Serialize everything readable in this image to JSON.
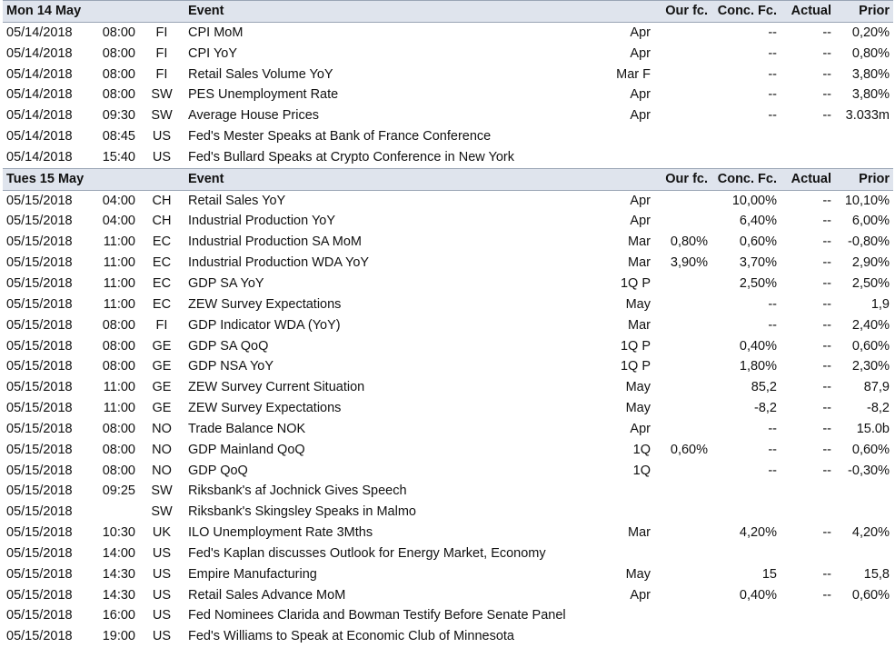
{
  "columns": {
    "event": "Event",
    "our_fc": "Our fc.",
    "conc_fc": "Conc. Fc.",
    "actual": "Actual",
    "prior": "Prior"
  },
  "sections": [
    {
      "title": "Mon 14 May",
      "rows": [
        {
          "date": "05/14/2018",
          "time": "08:00",
          "country": "FI",
          "event": "CPI MoM",
          "period": "Apr",
          "our": "",
          "conc": "--",
          "actual": "--",
          "prior": "0,20%"
        },
        {
          "date": "05/14/2018",
          "time": "08:00",
          "country": "FI",
          "event": "CPI YoY",
          "period": "Apr",
          "our": "",
          "conc": "--",
          "actual": "--",
          "prior": "0,80%"
        },
        {
          "date": "05/14/2018",
          "time": "08:00",
          "country": "FI",
          "event": "Retail Sales Volume YoY",
          "period": "Mar F",
          "our": "",
          "conc": "--",
          "actual": "--",
          "prior": "3,80%"
        },
        {
          "date": "05/14/2018",
          "time": "08:00",
          "country": "SW",
          "event": "PES Unemployment Rate",
          "period": "Apr",
          "our": "",
          "conc": "--",
          "actual": "--",
          "prior": "3,80%"
        },
        {
          "date": "05/14/2018",
          "time": "09:30",
          "country": "SW",
          "event": "Average House Prices",
          "period": "Apr",
          "our": "",
          "conc": "--",
          "actual": "--",
          "prior": "3.033m"
        },
        {
          "date": "05/14/2018",
          "time": "08:45",
          "country": "US",
          "event": "Fed's Mester Speaks at Bank of France Conference",
          "period": "",
          "our": "",
          "conc": "",
          "actual": "",
          "prior": ""
        },
        {
          "date": "05/14/2018",
          "time": "15:40",
          "country": "US",
          "event": "Fed's Bullard Speaks at Crypto Conference in New York",
          "period": "",
          "our": "",
          "conc": "",
          "actual": "",
          "prior": ""
        }
      ]
    },
    {
      "title": "Tues 15 May",
      "rows": [
        {
          "date": "05/15/2018",
          "time": "04:00",
          "country": "CH",
          "event": "Retail Sales YoY",
          "period": "Apr",
          "our": "",
          "conc": "10,00%",
          "actual": "--",
          "prior": "10,10%"
        },
        {
          "date": "05/15/2018",
          "time": "04:00",
          "country": "CH",
          "event": "Industrial Production YoY",
          "period": "Apr",
          "our": "",
          "conc": "6,40%",
          "actual": "--",
          "prior": "6,00%"
        },
        {
          "date": "05/15/2018",
          "time": "11:00",
          "country": "EC",
          "event": "Industrial Production SA MoM",
          "period": "Mar",
          "our": "0,80%",
          "conc": "0,60%",
          "actual": "--",
          "prior": "-0,80%"
        },
        {
          "date": "05/15/2018",
          "time": "11:00",
          "country": "EC",
          "event": "Industrial Production WDA YoY",
          "period": "Mar",
          "our": "3,90%",
          "conc": "3,70%",
          "actual": "--",
          "prior": "2,90%"
        },
        {
          "date": "05/15/2018",
          "time": "11:00",
          "country": "EC",
          "event": "GDP SA YoY",
          "period": "1Q P",
          "our": "",
          "conc": "2,50%",
          "actual": "--",
          "prior": "2,50%"
        },
        {
          "date": "05/15/2018",
          "time": "11:00",
          "country": "EC",
          "event": "ZEW Survey Expectations",
          "period": "May",
          "our": "",
          "conc": "--",
          "actual": "--",
          "prior": "1,9"
        },
        {
          "date": "05/15/2018",
          "time": "08:00",
          "country": "FI",
          "event": "GDP Indicator WDA (YoY)",
          "period": "Mar",
          "our": "",
          "conc": "--",
          "actual": "--",
          "prior": "2,40%"
        },
        {
          "date": "05/15/2018",
          "time": "08:00",
          "country": "GE",
          "event": "GDP SA QoQ",
          "period": "1Q P",
          "our": "",
          "conc": "0,40%",
          "actual": "--",
          "prior": "0,60%"
        },
        {
          "date": "05/15/2018",
          "time": "08:00",
          "country": "GE",
          "event": "GDP NSA YoY",
          "period": "1Q P",
          "our": "",
          "conc": "1,80%",
          "actual": "--",
          "prior": "2,30%"
        },
        {
          "date": "05/15/2018",
          "time": "11:00",
          "country": "GE",
          "event": "ZEW Survey Current Situation",
          "period": "May",
          "our": "",
          "conc": "85,2",
          "actual": "--",
          "prior": "87,9"
        },
        {
          "date": "05/15/2018",
          "time": "11:00",
          "country": "GE",
          "event": "ZEW Survey Expectations",
          "period": "May",
          "our": "",
          "conc": "-8,2",
          "actual": "--",
          "prior": "-8,2"
        },
        {
          "date": "05/15/2018",
          "time": "08:00",
          "country": "NO",
          "event": "Trade Balance NOK",
          "period": "Apr",
          "our": "",
          "conc": "--",
          "actual": "--",
          "prior": "15.0b"
        },
        {
          "date": "05/15/2018",
          "time": "08:00",
          "country": "NO",
          "event": "GDP Mainland QoQ",
          "period": "1Q",
          "our": "0,60%",
          "conc": "--",
          "actual": "--",
          "prior": "0,60%"
        },
        {
          "date": "05/15/2018",
          "time": "08:00",
          "country": "NO",
          "event": "GDP QoQ",
          "period": "1Q",
          "our": "",
          "conc": "--",
          "actual": "--",
          "prior": "-0,30%"
        },
        {
          "date": "05/15/2018",
          "time": "09:25",
          "country": "SW",
          "event": "Riksbank's af Jochnick Gives Speech",
          "period": "",
          "our": "",
          "conc": "",
          "actual": "",
          "prior": ""
        },
        {
          "date": "05/15/2018",
          "time": "",
          "country": "SW",
          "event": "Riksbank's Skingsley Speaks in Malmo",
          "period": "",
          "our": "",
          "conc": "",
          "actual": "",
          "prior": ""
        },
        {
          "date": "05/15/2018",
          "time": "10:30",
          "country": "UK",
          "event": "ILO Unemployment Rate 3Mths",
          "period": "Mar",
          "our": "",
          "conc": "4,20%",
          "actual": "--",
          "prior": "4,20%"
        },
        {
          "date": "05/15/2018",
          "time": "14:00",
          "country": "US",
          "event": "Fed's Kaplan discusses Outlook for Energy Market, Economy",
          "period": "",
          "our": "",
          "conc": "",
          "actual": "",
          "prior": ""
        },
        {
          "date": "05/15/2018",
          "time": "14:30",
          "country": "US",
          "event": "Empire Manufacturing",
          "period": "May",
          "our": "",
          "conc": "15",
          "actual": "--",
          "prior": "15,8"
        },
        {
          "date": "05/15/2018",
          "time": "14:30",
          "country": "US",
          "event": "Retail Sales Advance MoM",
          "period": "Apr",
          "our": "",
          "conc": "0,40%",
          "actual": "--",
          "prior": "0,60%"
        },
        {
          "date": "05/15/2018",
          "time": "16:00",
          "country": "US",
          "event": "Fed Nominees Clarida and Bowman Testify Before Senate Panel",
          "period": "",
          "our": "",
          "conc": "",
          "actual": "",
          "prior": ""
        },
        {
          "date": "05/15/2018",
          "time": "19:00",
          "country": "US",
          "event": "Fed's Williams to Speak at Economic Club of Minnesota",
          "period": "",
          "our": "",
          "conc": "",
          "actual": "",
          "prior": ""
        }
      ]
    }
  ]
}
